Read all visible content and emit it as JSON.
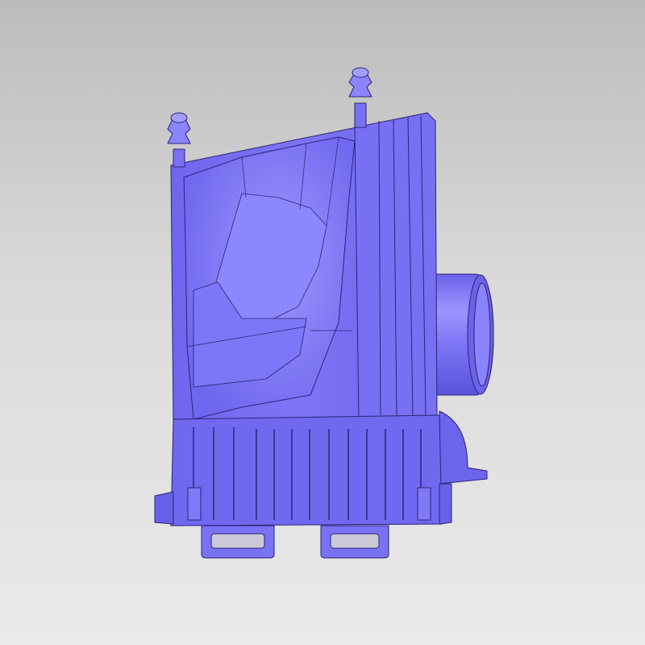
{
  "viewport": {
    "background_top": "#bcbcbc",
    "background_bottom": "#eaeaea"
  },
  "model": {
    "part": "cad-part-housing",
    "color": "#7b72f4",
    "shade_color": "#5b53d6",
    "highlight_color": "#a8a2ff",
    "edge_color": "#2a2478"
  }
}
